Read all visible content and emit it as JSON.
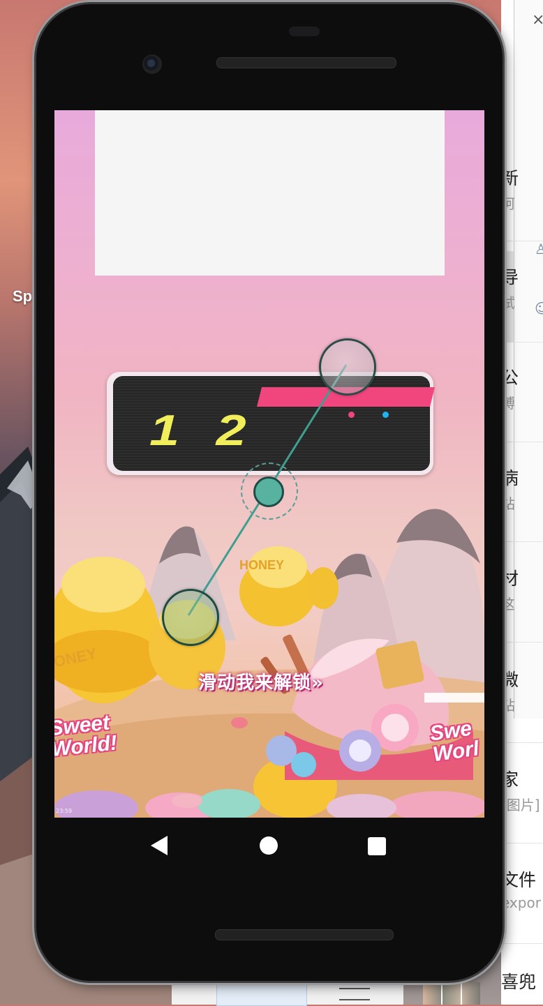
{
  "desktop": {
    "label": "Sp"
  },
  "side_panel": {
    "close_glyph": "×",
    "rows": [
      {
        "title": "新",
        "sub": "阿"
      },
      {
        "title": "导",
        "sub": "试"
      },
      {
        "title": "公",
        "sub": "膊"
      },
      {
        "title": "病",
        "sub": "站"
      },
      {
        "title": "材",
        "sub": "这"
      },
      {
        "title": "微",
        "sub": "钻"
      },
      {
        "title": "家",
        "sub": "[图片]"
      },
      {
        "title": "文件",
        "sub": "expor"
      },
      {
        "title": "喜兜"
      }
    ]
  },
  "phone": {
    "lock_screen": {
      "board_digits": "12",
      "unlock_hint": "滑动我来解锁»",
      "sweet_left": "Sweet World!",
      "sweet_right": "Swe Worl",
      "honey_label": "HONEY",
      "honey_label_2": "ONEY",
      "corner_tiny_text": "23:59"
    },
    "nav": {
      "back_icon": "back-triangle",
      "home_icon": "home-circle",
      "recent_icon": "recent-square"
    }
  },
  "colors": {
    "board_stripe": "#f1457e",
    "digits": "#f1ee5c",
    "pattern_knob": "#58b2a0"
  }
}
